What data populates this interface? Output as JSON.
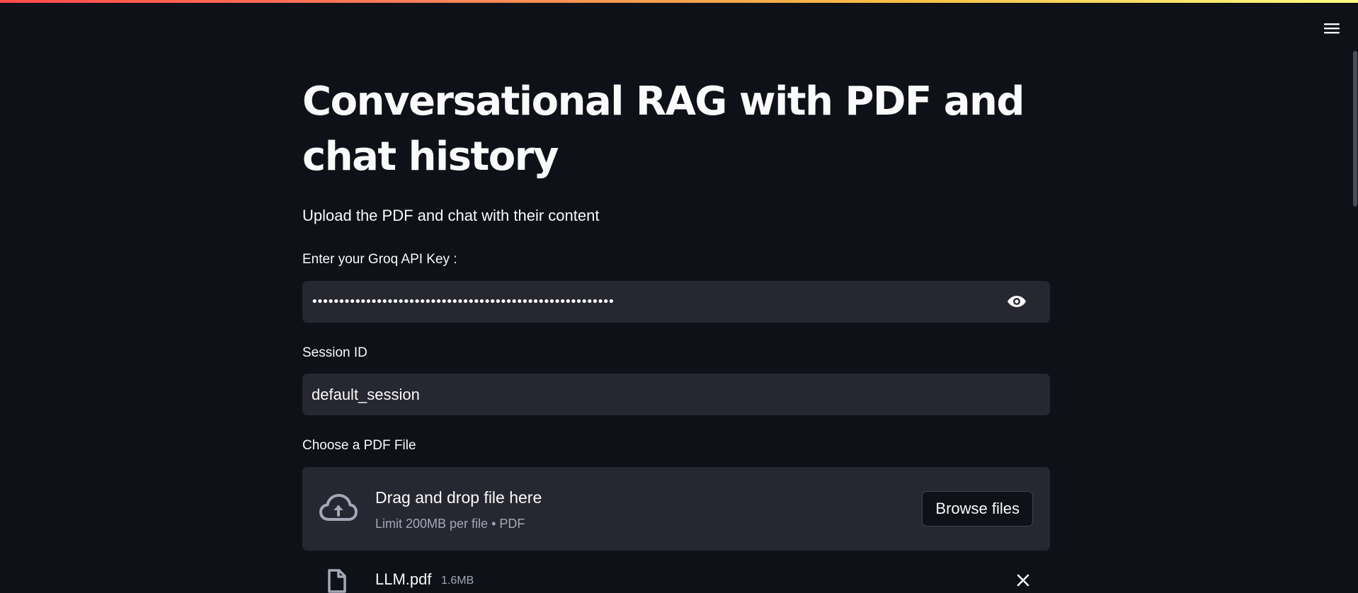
{
  "app": {
    "title": "Conversational RAG with PDF and chat history",
    "subtitle": "Upload the PDF and chat with their content",
    "accent_gradient": [
      "#ff4b4b",
      "#ffbd45",
      "#fffd80"
    ],
    "background": "#0e1117",
    "menu_icon": "hamburger-menu-icon"
  },
  "api_key": {
    "label": "Enter your Groq API Key :",
    "masked_value": "••••••••••••••••••••••••••••••••••••••••••••••••••••••••",
    "visibility_icon": "eye-icon"
  },
  "session": {
    "label": "Session ID",
    "value": "default_session"
  },
  "uploader": {
    "label": "Choose a PDF File",
    "dropzone_title": "Drag and drop file here",
    "dropzone_limit": "Limit 200MB per file • PDF",
    "browse_label": "Browse files",
    "upload_icon": "cloud-upload-icon",
    "files": [
      {
        "name": "LLM.pdf",
        "size": "1.6MB",
        "icon": "file-icon",
        "remove_icon": "close-icon"
      }
    ]
  }
}
